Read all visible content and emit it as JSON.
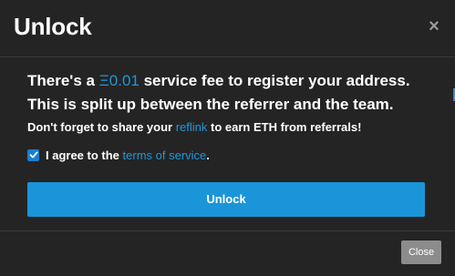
{
  "modal": {
    "title": "Unlock",
    "close_icon_glyph": "×"
  },
  "body": {
    "line1_prefix": "There's a ",
    "eth_symbol": "Ξ",
    "eth_amount": "0.01",
    "line1_suffix": " service fee to register your address.",
    "line2": "This is split up between the referrer and the team.",
    "line3_prefix": "Don't forget to share your ",
    "reflink_label": "reflink",
    "line3_suffix": " to earn ETH from referrals!",
    "agree_checked": true,
    "agree_prefix": "I agree to the ",
    "terms_label": "terms of service",
    "agree_suffix": "."
  },
  "buttons": {
    "unlock_label": "Unlock",
    "close_label": "Close"
  },
  "colors": {
    "background": "#242424",
    "accent": "#2196d9",
    "button_primary": "#1a95d9",
    "button_close": "#8c8c8c"
  }
}
